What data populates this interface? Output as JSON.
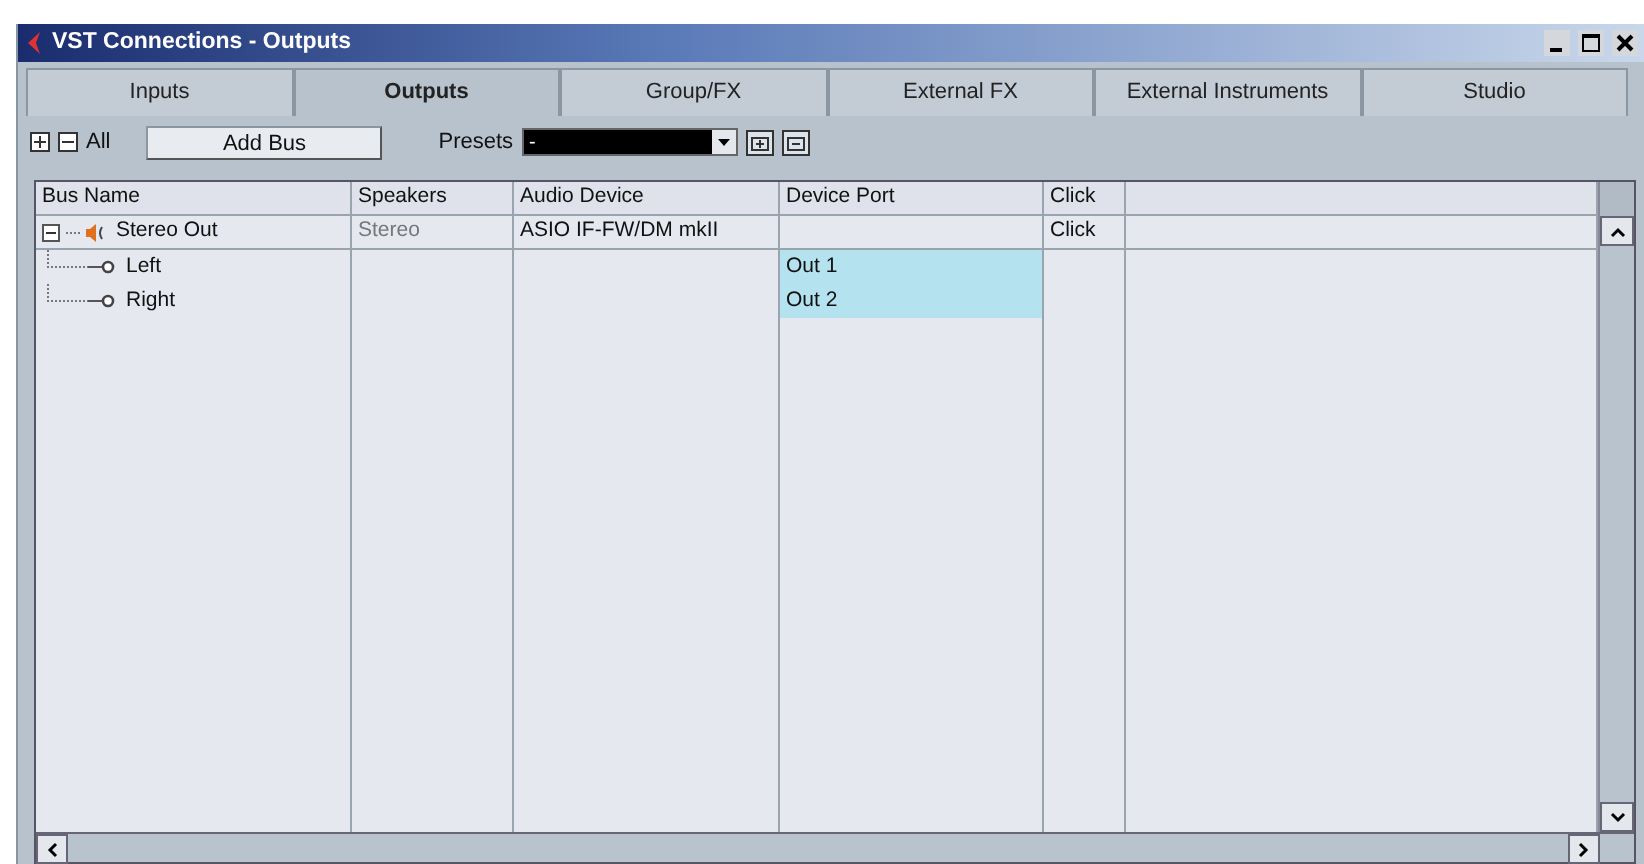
{
  "window": {
    "title": "VST Connections - Outputs"
  },
  "tabs": [
    {
      "label": "Inputs",
      "selected": false
    },
    {
      "label": "Outputs",
      "selected": true
    },
    {
      "label": "Group/FX",
      "selected": false
    },
    {
      "label": "External FX",
      "selected": false
    },
    {
      "label": "External Instruments",
      "selected": false
    },
    {
      "label": "Studio",
      "selected": false
    }
  ],
  "toolbar": {
    "all_label": "All",
    "add_bus": "Add Bus",
    "presets_label": "Presets",
    "presets_value": "-"
  },
  "table": {
    "columns": [
      "Bus Name",
      "Speakers",
      "Audio Device",
      "Device Port",
      "Click"
    ],
    "rows": [
      {
        "name": "Stereo Out",
        "speakers": "Stereo",
        "audio_device": "ASIO IF-FW/DM mkII",
        "device_port": "",
        "click": "Click",
        "expanded": true,
        "children": [
          {
            "name": "Left",
            "device_port": "Out 1",
            "port_highlighted": true
          },
          {
            "name": "Right",
            "device_port": "Out 2",
            "port_highlighted": true
          }
        ]
      }
    ]
  }
}
